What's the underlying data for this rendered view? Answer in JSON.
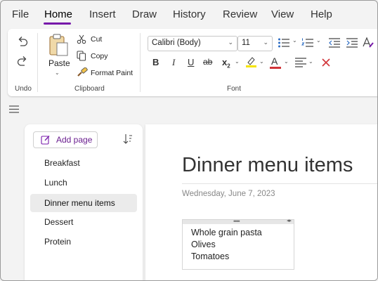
{
  "menu": {
    "tabs": [
      "File",
      "Home",
      "Insert",
      "Draw",
      "History",
      "Review",
      "View",
      "Help"
    ],
    "active": "Home",
    "accent": "#7719aa"
  },
  "ribbon": {
    "undo_group": {
      "label": "Undo",
      "undo_icon": "undo-icon",
      "redo_icon": "redo-icon"
    },
    "clipboard_group": {
      "label": "Clipboard",
      "paste": "Paste",
      "cut": "Cut",
      "copy": "Copy",
      "format_paint": "Format Paint"
    },
    "font_group": {
      "label": "Font",
      "font_name": "Calibri (Body)",
      "font_size": "11",
      "bold": "B",
      "italic": "I",
      "underline": "U",
      "strikethrough": "ab",
      "subscript": "x",
      "subscript_sub": "2",
      "font_color_letter": "A",
      "highlight_color": "#f5e400",
      "font_color": "#d13438",
      "clear_color": "#d13438"
    }
  },
  "sidebar": {
    "add_page": "Add page",
    "pages": [
      "Breakfast",
      "Lunch",
      "Dinner menu items",
      "Dessert",
      "Protein"
    ],
    "selected": "Dinner menu items"
  },
  "page": {
    "title": "Dinner menu items",
    "date": "Wednesday, June 7, 2023",
    "note_lines": [
      "Whole grain pasta",
      "Olives",
      "Tomatoes"
    ],
    "note_grip": "••••",
    "note_arrows": "◂▸"
  }
}
